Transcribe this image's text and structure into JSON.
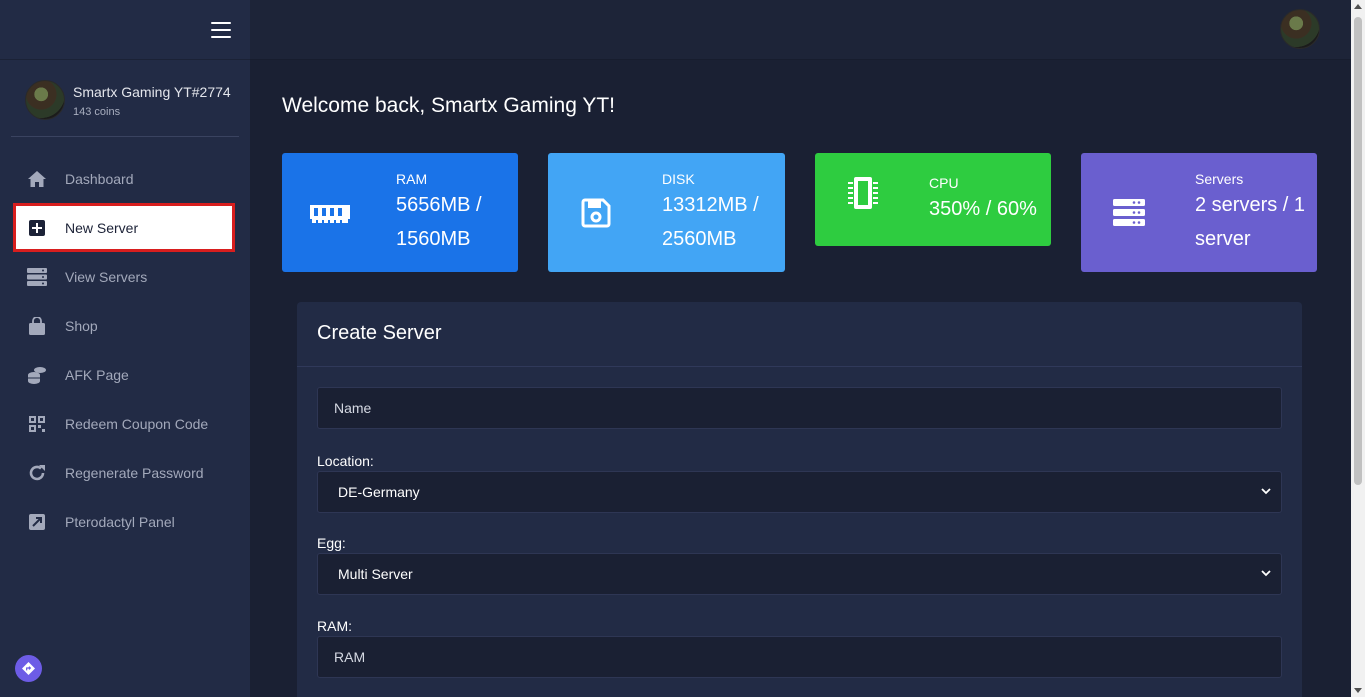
{
  "sidebar": {
    "profile": {
      "name": "Smartx Gaming YT#2774",
      "coins": "143 coins"
    },
    "items": [
      {
        "label": "Dashboard",
        "icon": "home-icon"
      },
      {
        "label": "New Server",
        "icon": "plus-square-icon",
        "active": true
      },
      {
        "label": "View Servers",
        "icon": "server-icon"
      },
      {
        "label": "Shop",
        "icon": "shopping-bag-icon"
      },
      {
        "label": "AFK Page",
        "icon": "coins-icon"
      },
      {
        "label": "Redeem Coupon Code",
        "icon": "qrcode-icon"
      },
      {
        "label": "Regenerate Password",
        "icon": "redo-icon"
      },
      {
        "label": "Pterodactyl Panel",
        "icon": "external-link-icon"
      }
    ],
    "highlight_color": "#d81e1e"
  },
  "main": {
    "welcome": "Welcome back, Smartx Gaming YT!",
    "cards": [
      {
        "label": "RAM",
        "value_line1": "5656MB /",
        "value_line2": "1560MB",
        "color": "#1a73e8",
        "icon": "memory-icon"
      },
      {
        "label": "DISK",
        "value_line1": "13312MB /",
        "value_line2": "2560MB",
        "color": "#42a5f5",
        "icon": "save-icon"
      },
      {
        "label": "CPU",
        "value_line1": "350% / 60%",
        "value_line2": "",
        "color": "#2ecc40",
        "icon": "microchip-icon"
      },
      {
        "label": "Servers",
        "value_line1": "2 servers / 1",
        "value_line2": "server",
        "color": "#6a5fcf",
        "icon": "server-stack-icon"
      }
    ],
    "form": {
      "title": "Create Server",
      "name_placeholder": "Name",
      "location_label": "Location:",
      "location_value": "DE-Germany",
      "egg_label": "Egg:",
      "egg_value": "Multi Server",
      "ram_label": "RAM:",
      "ram_placeholder": "RAM"
    }
  }
}
